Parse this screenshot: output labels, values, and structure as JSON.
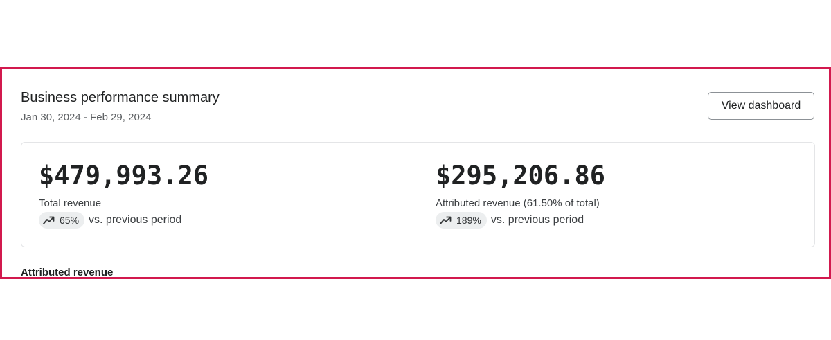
{
  "header": {
    "title": "Business performance summary",
    "date_range": "Jan 30, 2024 - Feb 29, 2024",
    "view_dashboard_label": "View dashboard"
  },
  "metrics": [
    {
      "amount": "$479,993.26",
      "label": "Total revenue",
      "change": "65%",
      "change_icon": "trending-up-icon",
      "comparison_text": "vs. previous period"
    },
    {
      "amount": "$295,206.86",
      "label": "Attributed revenue (61.50% of total)",
      "change": "189%",
      "change_icon": "trending-up-icon",
      "comparison_text": "vs. previous period"
    }
  ],
  "section": {
    "heading": "Attributed revenue"
  },
  "colors": {
    "frame_border": "#d2194e",
    "pill_background": "#eceeef",
    "text_primary": "#202223",
    "text_secondary": "#5c5f62"
  }
}
